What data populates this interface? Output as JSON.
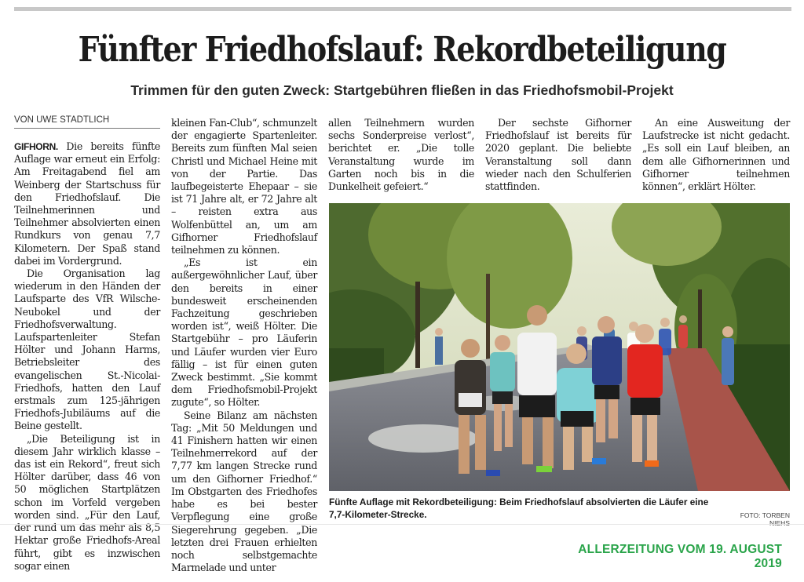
{
  "article": {
    "headline": "Fünfter Friedhofslauf: Rekordbeteiligung",
    "subheadline": "Trimmen für den guten Zweck: Startgebühren fließen in das Friedhofsmobil-Projekt",
    "byline": "VON UWE STADTLICH",
    "dateline": "GIFHORN.",
    "col1": {
      "p1": "Die bereits fünfte Auflage war erneut ein Erfolg: Am Freitagabend fiel am Weinberg der Startschuss für den Friedhofslauf. Die Teilnehmerinnen und Teilnehmer absolvierten einen Rundkurs von genau 7,7 Kilometern. Der Spaß stand dabei im Vordergrund.",
      "p2": "Die Organisation lag wiederum in den Händen der Laufsparte des VfR Wilsche-Neubokel und der Friedhofsverwaltung. Laufspartenleiter Stefan Hölter und Johann Harms, Betriebsleiter des evangelischen St.-Nicolai-Friedhofs, hatten den Lauf erstmals zum 125-jährigen Friedhofs-Jubiläums auf die Beine gestellt.",
      "p3": "„Die Beteiligung ist in diesem Jahr wirklich klasse – das ist ein Rekord“, freut sich Hölter darüber, dass 46 von 50 möglichen Startplätzen schon im Vorfeld vergeben worden sind. „Für den Lauf, der rund um das mehr als 8,5 Hektar große Friedhofs-Areal führt, gibt es inzwischen sogar einen"
    },
    "col2": {
      "p1": "kleinen Fan-Club“, schmunzelt der engagierte Spartenleiter. Bereits zum fünften Mal seien Christl und Michael Heine mit von der Partie. Das laufbegeisterte Ehepaar – sie ist 71 Jahre alt, er 72 Jahre alt – reisten extra aus Wolfenbüttel an, um am Gifhorner Friedhofslauf teilnehmen zu können.",
      "p2": "„Es ist ein außergewöhnlicher Lauf, über den bereits in einer bundesweit erscheinenden Fachzeitung geschrieben worden ist“, weiß Hölter. Die Startgebühr – pro Läuferin und Läufer wurden vier Euro fällig – ist für einen guten Zweck bestimmt. „Sie kommt dem Friedhofsmobil-Projekt zugute“, so Hölter.",
      "p3": "Seine Bilanz am nächsten Tag: „Mit 50 Meldungen und 41 Finishern hatten wir einen Teilnehmerrekord auf der 7,77 km langen Strecke rund um den Gifhorner Friedhof.“ Im Obstgarten des Friedhofes habe es bei bester Verpflegung eine große Siegerehrung gegeben. „Die letzten drei Frauen erhielten noch selbstgemachte Marmelade und unter"
    },
    "col3": {
      "p1": "allen Teilnehmern wurden sechs Sonderpreise verlost“, berichtet er. „Die tolle Veranstaltung wurde im Garten noch bis in die Dunkelheit gefeiert.“"
    },
    "col4": {
      "p1": "Der sechste Gifhorner Friedhofslauf ist bereits für 2020 geplant. Die beliebte Veranstaltung soll dann wieder nach den Schulferien stattfinden."
    },
    "col5": {
      "p1": "An eine Ausweitung der Laufstrecke ist nicht gedacht. „Es soll ein Lauf bleiben, an dem alle Gifhornerinnen und Gifhorner teilnehmen können“, erklärt Hölter."
    },
    "photo": {
      "caption": "Fünfte Auflage mit Rekordbeteiligung: Beim Friedhofslauf absolvierten die Läufer eine 7,7-Kilometer-Strecke.",
      "credit": "FOTO: TORBEN NIEHS"
    }
  },
  "footer": {
    "source": "ALLERZEITUNG VOM 19. AUGUST 2019"
  },
  "colors": {
    "footer_accent": "#2aa44a",
    "rule_gray": "#c8c8c8"
  }
}
